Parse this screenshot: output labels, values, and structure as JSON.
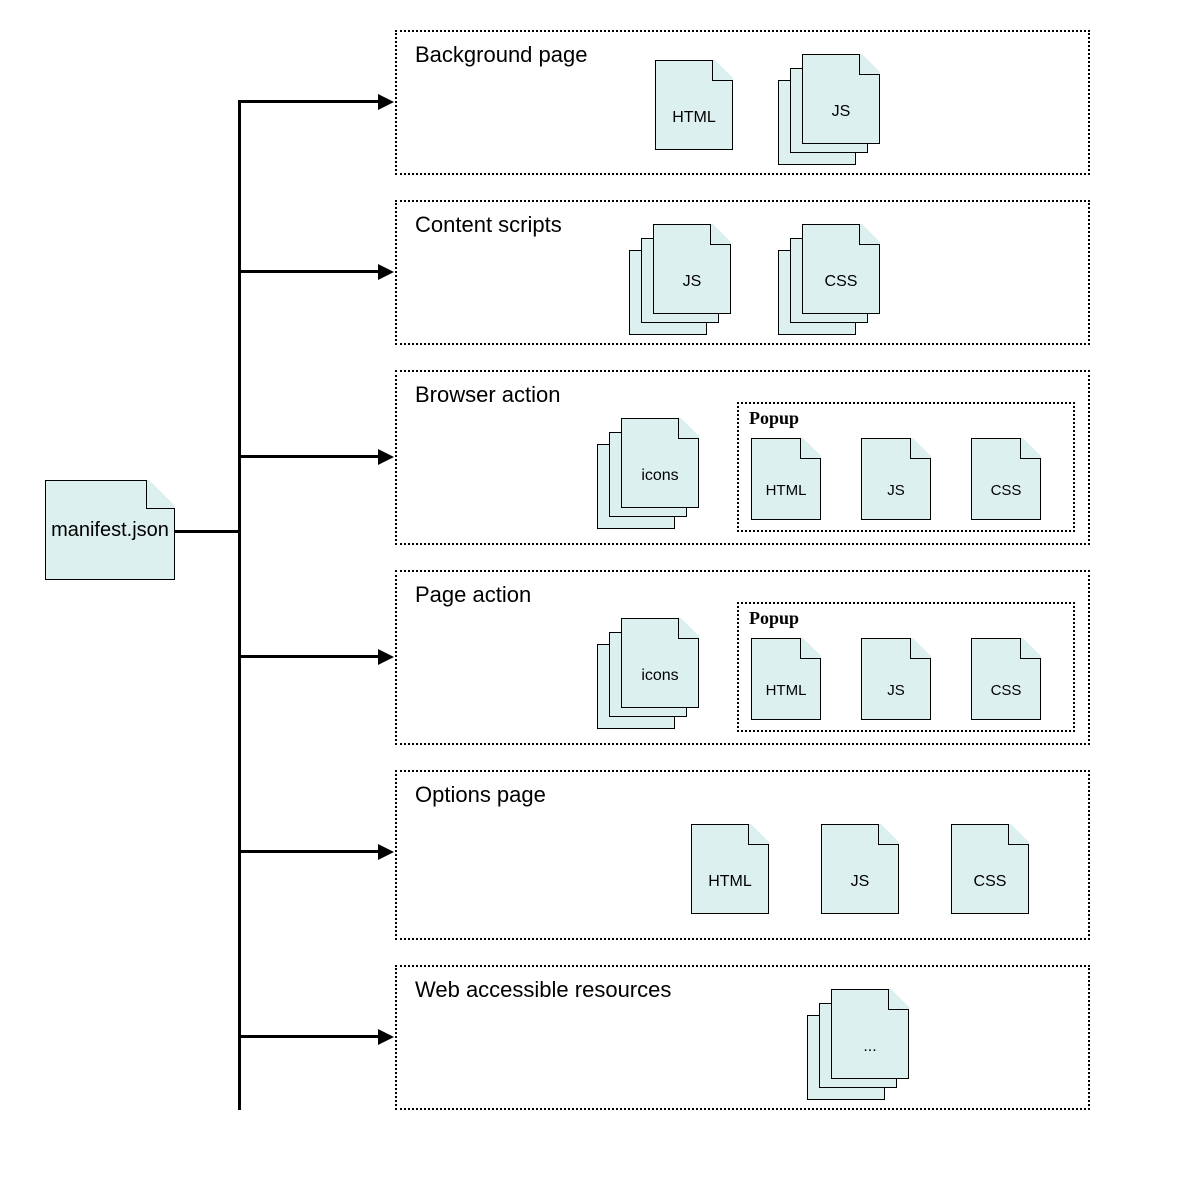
{
  "root": {
    "label": "manifest.json"
  },
  "sections": [
    {
      "title": "Background page",
      "files": [
        "HTML",
        "JS"
      ]
    },
    {
      "title": "Content scripts",
      "files": [
        "JS",
        "CSS"
      ]
    },
    {
      "title": "Browser action",
      "files": [
        "icons"
      ],
      "popup": {
        "title": "Popup",
        "files": [
          "HTML",
          "JS",
          "CSS"
        ]
      }
    },
    {
      "title": "Page action",
      "files": [
        "icons"
      ],
      "popup": {
        "title": "Popup",
        "files": [
          "HTML",
          "JS",
          "CSS"
        ]
      }
    },
    {
      "title": "Options page",
      "files": [
        "HTML",
        "JS",
        "CSS"
      ]
    },
    {
      "title": "Web accessible resources",
      "files": [
        "..."
      ]
    }
  ],
  "colors": {
    "file_bg": "#dcf0ef",
    "border": "#000000"
  }
}
